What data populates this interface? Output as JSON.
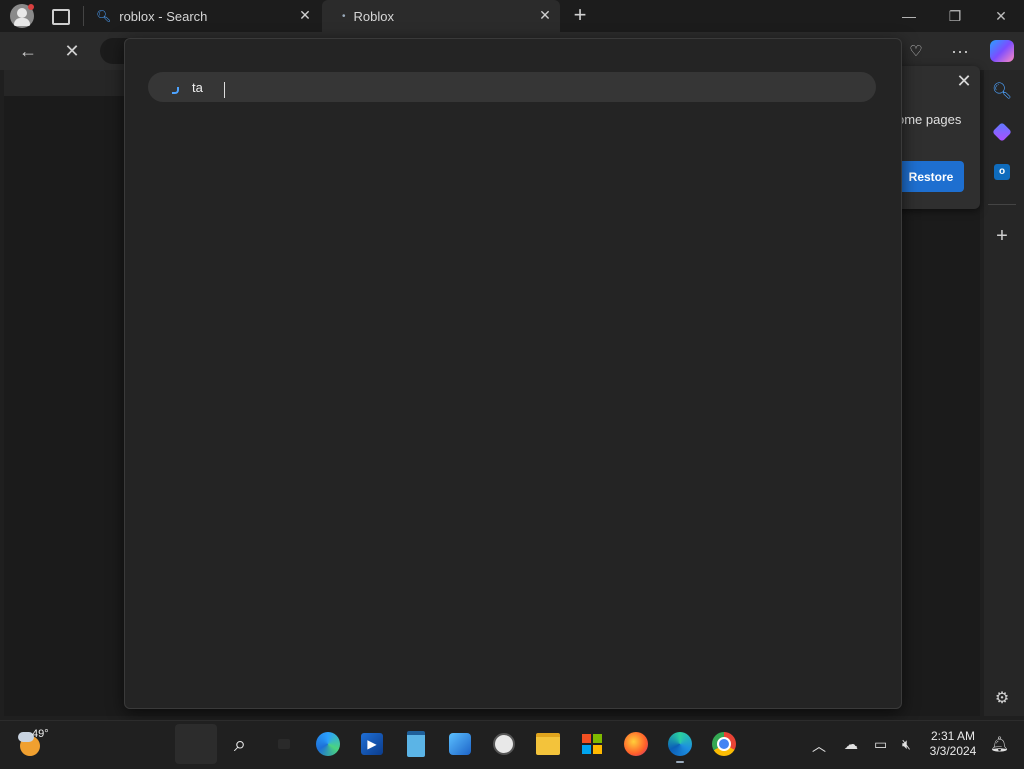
{
  "tabs": [
    {
      "title": "roblox - Search"
    },
    {
      "title": "Roblox"
    }
  ],
  "search": {
    "query": "ta"
  },
  "restore_popup": {
    "text": "ome pages",
    "button": "Restore"
  },
  "taskbar": {
    "weather_temp": "49°",
    "time": "2:31 AM",
    "date": "3/3/2024"
  },
  "colors": {
    "accent": "#1e6fd0",
    "background": "#1f1f1f"
  }
}
